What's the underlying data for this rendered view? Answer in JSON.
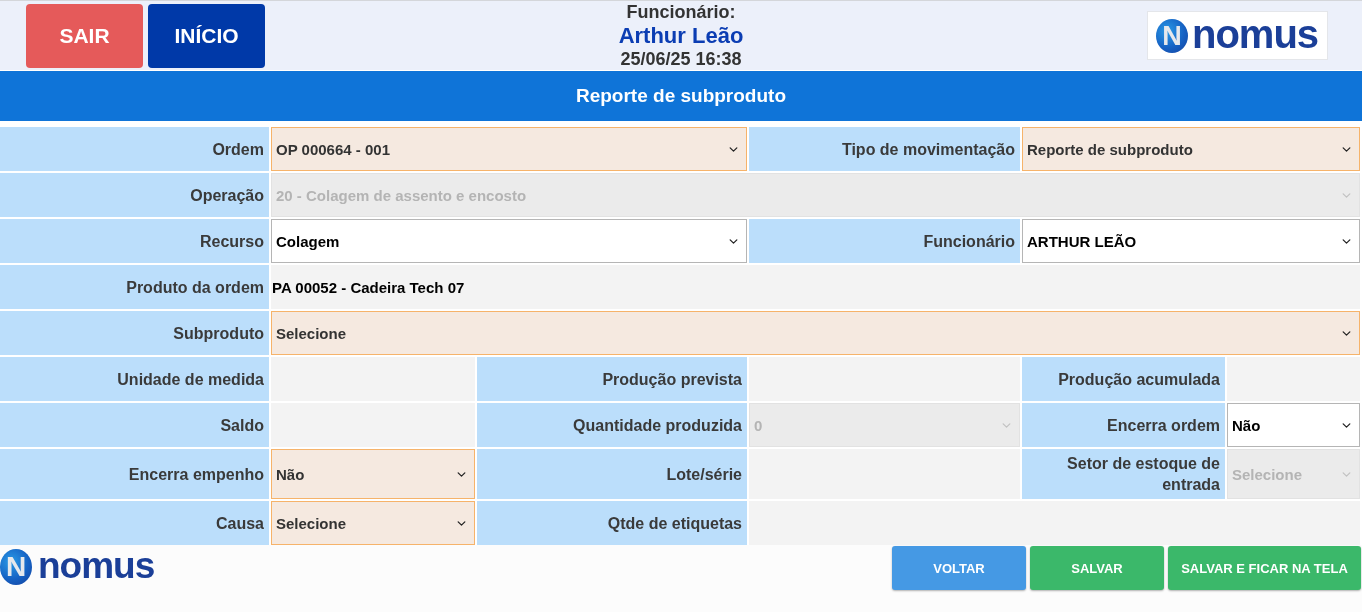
{
  "header": {
    "buttons": [
      {
        "label": "SAIR",
        "kind": "exit"
      },
      {
        "label": "INÍCIO",
        "kind": "home"
      }
    ],
    "caption": "Funcionário:",
    "employee": "Arthur Leão",
    "datetime": "25/06/25 16:38",
    "logo": {
      "mark": "N",
      "text": "nomus"
    }
  },
  "title": "Reporte de subproduto",
  "form": {
    "rows": [
      {
        "kind": "halves",
        "fields": [
          {
            "label": "Ordem",
            "kind": "select",
            "value": "OP 000664 - 001",
            "required": true,
            "disabled": false
          },
          {
            "label": "Tipo de movimentação",
            "kind": "select",
            "value": "Reporte de subproduto",
            "required": true,
            "disabled": false
          }
        ]
      },
      {
        "kind": "full",
        "fields": [
          {
            "label": "Operação",
            "kind": "select",
            "value": "20 - Colagem de assento e encosto",
            "required": false,
            "disabled": true
          }
        ]
      },
      {
        "kind": "halves",
        "fields": [
          {
            "label": "Recurso",
            "kind": "select",
            "value": "Colagem",
            "required": false,
            "disabled": false
          },
          {
            "label": "Funcionário",
            "kind": "select",
            "value": "ARTHUR LEÃO",
            "required": false,
            "disabled": false
          }
        ]
      },
      {
        "kind": "full",
        "fields": [
          {
            "label": "Produto da ordem",
            "kind": "display",
            "value": "PA 00052 - Cadeira Tech 07"
          }
        ]
      },
      {
        "kind": "full",
        "fields": [
          {
            "label": "Subproduto",
            "kind": "select",
            "value": "Selecione",
            "required": true,
            "disabled": false
          }
        ]
      },
      {
        "kind": "thirds",
        "fields": [
          {
            "label": "Unidade de medida",
            "kind": "display"
          },
          {
            "label": "Produção prevista",
            "kind": "display"
          },
          {
            "label": "Produção acumulada",
            "kind": "display"
          }
        ]
      },
      {
        "kind": "thirds",
        "fields": [
          {
            "label": "Saldo",
            "kind": "display"
          },
          {
            "label": "Quantidade produzida",
            "kind": "select",
            "value": "0",
            "required": false,
            "disabled": true
          },
          {
            "label": "Encerra ordem",
            "kind": "select",
            "value": "Não",
            "required": false,
            "disabled": false
          }
        ]
      },
      {
        "kind": "thirds",
        "fields": [
          {
            "label": "Encerra empenho",
            "kind": "select",
            "value": "Não",
            "required": true,
            "disabled": false
          },
          {
            "label": "Lote/série",
            "kind": "display"
          },
          {
            "label": "Setor de estoque de entrada",
            "kind": "select",
            "value": "Selecione",
            "required": false,
            "disabled": true
          }
        ]
      },
      {
        "kind": "thirds",
        "fields": [
          {
            "label": "Causa",
            "kind": "select",
            "value": "Selecione",
            "required": true,
            "disabled": false
          },
          {
            "label": "Qtde de etiquetas",
            "kind": "display"
          }
        ]
      }
    ]
  },
  "footer": {
    "logo": {
      "mark": "N",
      "text": "nomus"
    },
    "buttons": [
      {
        "label": "VOLTAR",
        "kind": "back"
      },
      {
        "label": "SALVAR",
        "kind": "save"
      },
      {
        "label": "SALVAR E FICAR NA TELA",
        "kind": "save_stay"
      }
    ]
  }
}
